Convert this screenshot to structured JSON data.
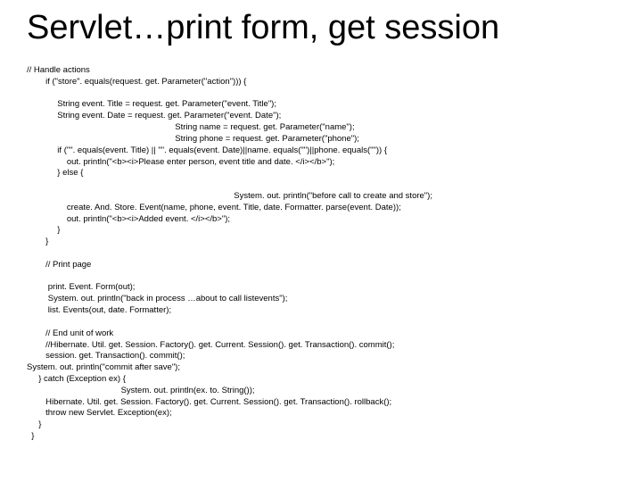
{
  "title": "Servlet…print form, get session",
  "code": "// Handle actions\n        if (\"store\". equals(request. get. Parameter(\"action\"))) {\n\n             String event. Title = request. get. Parameter(\"event. Title\");\n             String event. Date = request. get. Parameter(\"event. Date\");\n                                                               String name = request. get. Parameter(\"name\");\n                                                               String phone = request. get. Parameter(\"phone\");\n             if (\"\". equals(event. Title) || \"\". equals(event. Date)||name. equals(\"\")||phone. equals(\"\")) {\n                 out. println(\"<b><i>Please enter person, event title and date. </i></b>\");\n             } else {\n\n                                                                                        System. out. println(\"before call to create and store\");\n                 create. And. Store. Event(name, phone, event. Title, date. Formatter. parse(event. Date));\n                 out. println(\"<b><i>Added event. </i></b>\");\n             }\n        }\n\n        // Print page\n\n         print. Event. Form(out);\n         System. out. println(\"back in process …about to call listevents\");\n         list. Events(out, date. Formatter);\n\n        // End unit of work\n        //Hibernate. Util. get. Session. Factory(). get. Current. Session(). get. Transaction(). commit();\n        session. get. Transaction(). commit();\nSystem. out. println(\"commit after save\");\n     } catch (Exception ex) {\n                                        System. out. println(ex. to. String());\n        Hibernate. Util. get. Session. Factory(). get. Current. Session(). get. Transaction(). rollback();\n        throw new Servlet. Exception(ex);\n     }\n  }"
}
